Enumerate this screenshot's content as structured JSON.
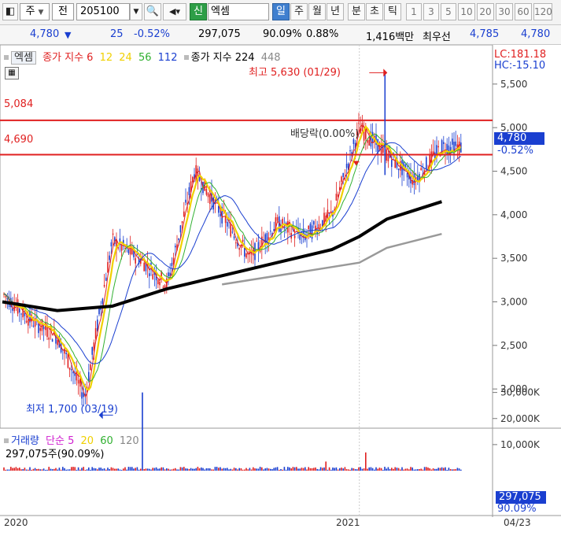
{
  "toolbar": {
    "market": "주",
    "prev": "전",
    "code": "205100",
    "badge": "신",
    "name": "엑셈",
    "periods": [
      {
        "label": "일",
        "selected": true
      },
      {
        "label": "주"
      },
      {
        "label": "월"
      },
      {
        "label": "년"
      },
      {
        "label": "분"
      },
      {
        "label": "초"
      },
      {
        "label": "틱"
      }
    ],
    "intervals": [
      "1",
      "3",
      "5",
      "10",
      "20",
      "30",
      "60",
      "120"
    ]
  },
  "quote": {
    "price": "4,780",
    "arrow": "▼",
    "change": "25",
    "change_pct": "-0.52%",
    "volume": "297,075",
    "vol_ratio": "90.09%",
    "turnover": "0.88%",
    "amount": "1,416백만",
    "bid_label": "최우선",
    "bid": "4,785",
    "ask": "4,780"
  },
  "legend": {
    "tag": "엑셈",
    "title": "종가 지수 6",
    "ma": [
      "12",
      "24",
      "56",
      "112"
    ],
    "ma_colors": [
      "#f0d000",
      "#30b030",
      "#1a3fd0"
    ],
    "title2": "종가 지수 224",
    "ma2": "448",
    "lc": "LC:181.18",
    "hc": "HC:-15.10"
  },
  "annotations": {
    "high": "최고 5,630 (01/29)",
    "low": "최저 1,700 (03/19)",
    "dividend": "배당락(0.00%)",
    "line_high": "5,084",
    "line_low": "4,690",
    "last_price": "4,780",
    "last_pct": "-0.52%"
  },
  "volume_panel": {
    "legend_title": "거래량",
    "legend_ma": "단순 5",
    "legend_ma_vals": [
      "20",
      "60",
      "120"
    ],
    "info": "297,075주(90.09%)",
    "last_vol": "297,075",
    "last_pct": "90.09%"
  },
  "x_axis": {
    "labels": [
      "2020",
      "2021"
    ],
    "end": "04/23"
  },
  "colors": {
    "up": "#e02020",
    "down": "#1a3fd0",
    "ma6": "#e02020",
    "ma12": "#f0d000",
    "ma24": "#30b030",
    "ma56": "#1a3fd0",
    "ma112": "#000000",
    "ma224": "#999999"
  },
  "chart_data": {
    "type": "line",
    "title": "엑셈",
    "y_ticks": [
      2000,
      2500,
      3000,
      3500,
      4000,
      4500,
      5000,
      5500
    ],
    "y_tick_labels": [
      "2,000",
      "2,500",
      "3,000",
      "3,500",
      "4,000",
      "4,500",
      "5,000",
      "5,500"
    ],
    "ylim": [
      1550,
      5950
    ],
    "x_ticks": [
      "2020",
      "2021",
      "04/23"
    ],
    "x_range": [
      "2019-12",
      "2021-04-23"
    ],
    "price_series": [
      {
        "x": "2019-12",
        "close": 3100
      },
      {
        "x": "2020-01",
        "close": 2800
      },
      {
        "x": "2020-02",
        "close": 2600
      },
      {
        "x": "2020-03",
        "close": 1900
      },
      {
        "x": "2020-04",
        "close": 3700
      },
      {
        "x": "2020-05",
        "close": 3500
      },
      {
        "x": "2020-06",
        "close": 3200
      },
      {
        "x": "2020-07",
        "close": 4500
      },
      {
        "x": "2020-08",
        "close": 4000
      },
      {
        "x": "2020-09",
        "close": 3500
      },
      {
        "x": "2020-10",
        "close": 3900
      },
      {
        "x": "2020-11",
        "close": 3750
      },
      {
        "x": "2020-12",
        "close": 4000
      },
      {
        "x": "2021-01",
        "close": 5000
      },
      {
        "x": "2021-02",
        "close": 4700
      },
      {
        "x": "2021-03",
        "close": 4400
      },
      {
        "x": "2021-04",
        "close": 4780
      }
    ],
    "ma112": [
      {
        "x": "2019-12",
        "y": 3000
      },
      {
        "x": "2020-02",
        "y": 2900
      },
      {
        "x": "2020-04",
        "y": 2950
      },
      {
        "x": "2020-06",
        "y": 3150
      },
      {
        "x": "2020-08",
        "y": 3300
      },
      {
        "x": "2020-10",
        "y": 3450
      },
      {
        "x": "2020-12",
        "y": 3600
      },
      {
        "x": "2021-01",
        "y": 3750
      },
      {
        "x": "2021-02",
        "y": 3950
      },
      {
        "x": "2021-03",
        "y": 4050
      },
      {
        "x": "2021-04",
        "y": 4150
      }
    ],
    "ma224": [
      {
        "x": "2020-08",
        "y": 3200
      },
      {
        "x": "2020-11",
        "y": 3350
      },
      {
        "x": "2021-01",
        "y": 3450
      },
      {
        "x": "2021-02",
        "y": 3620
      },
      {
        "x": "2021-04",
        "y": 3780
      }
    ],
    "high": {
      "x": "2021-01-29",
      "y": 5630
    },
    "low": {
      "x": "2020-03-19",
      "y": 1700
    },
    "hlines": [
      5084,
      4690
    ],
    "last": 4780,
    "volume_ticks": [
      "10,000K",
      "20,000K",
      "30,000K"
    ]
  }
}
